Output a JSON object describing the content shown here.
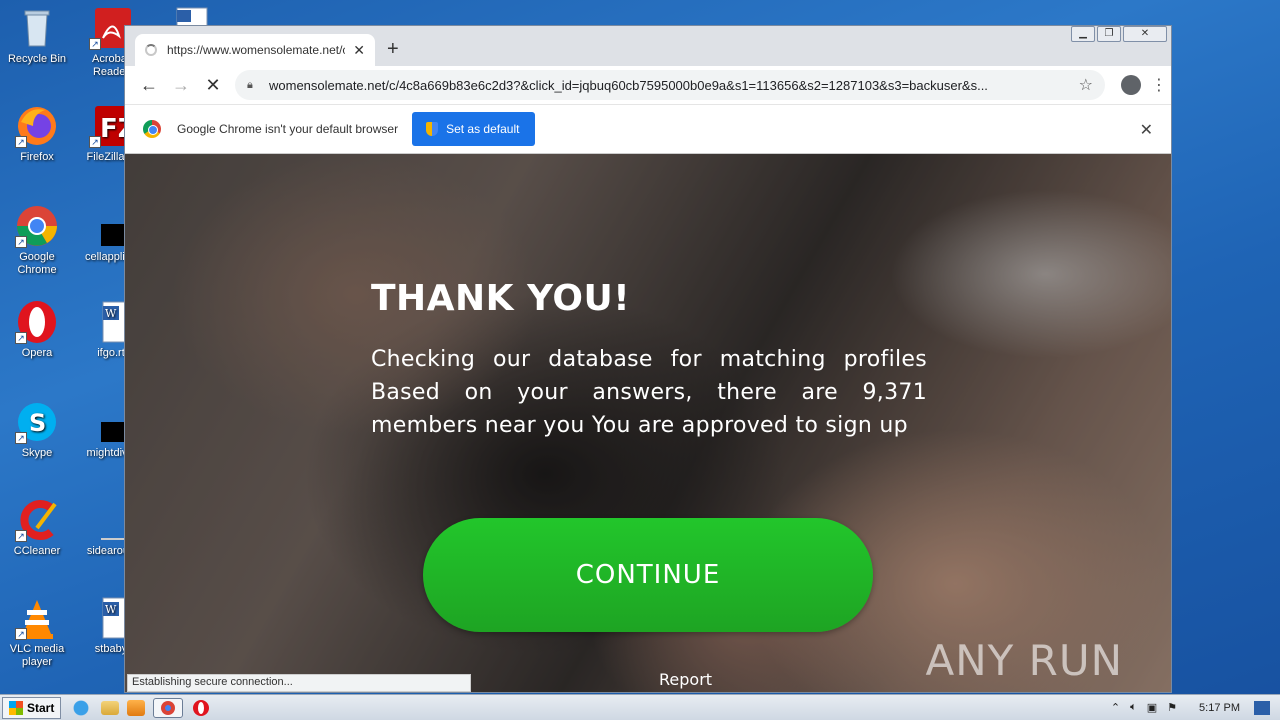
{
  "desktop": {
    "icons": [
      {
        "label": "Recycle Bin"
      },
      {
        "label": "Acrobat Reader"
      },
      {
        "label": "Firefox"
      },
      {
        "label": "FileZilla C"
      },
      {
        "label": "Google Chrome"
      },
      {
        "label": "cellapplied"
      },
      {
        "label": "Opera"
      },
      {
        "label": "ifgo.rt"
      },
      {
        "label": "Skype"
      },
      {
        "label": "mightdivis"
      },
      {
        "label": "CCleaner"
      },
      {
        "label": "sidearoun"
      },
      {
        "label": "VLC media player"
      },
      {
        "label": "stbaby"
      }
    ]
  },
  "browser": {
    "tab_title": "https://www.womensolemate.net/c/",
    "tab_close": "✕",
    "new_tab": "+",
    "url": "womensolemate.net/c/4c8a669b83e6c2d3?&click_id=jqbuq60cb7595000b0e9a&s1=113656&s2=1287103&s3=backuser&s...",
    "infobar_text": "Google Chrome isn't your default browser",
    "infobar_button": "Set as default",
    "status": "Establishing secure connection..."
  },
  "page": {
    "headline": "THANK YOU!",
    "body": "Checking our database for matching profiles Based on your answers, there are 9,371 members near you You are approved to sign up",
    "continue_label": "CONTINUE",
    "report_label": "Report",
    "watermark": "ANY RUN"
  },
  "taskbar": {
    "start_label": "Start",
    "clock": "5:17 PM"
  }
}
